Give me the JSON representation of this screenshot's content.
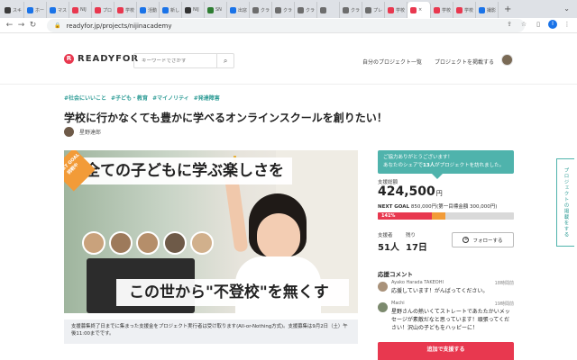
{
  "browser": {
    "tabs": [
      {
        "label": "スキ",
        "color": "#3c3c3c"
      },
      {
        "label": "ホー",
        "color": "#1a73e8"
      },
      {
        "label": "マス",
        "color": "#1a73e8"
      },
      {
        "label": "NIJ",
        "color": "#e8384f"
      },
      {
        "label": "プロ",
        "color": "#e8384f"
      },
      {
        "label": "学校",
        "color": "#e8384f"
      },
      {
        "label": "活動",
        "color": "#1a73e8"
      },
      {
        "label": "新し",
        "color": "#1a73e8"
      },
      {
        "label": "NIJ",
        "color": "#333333"
      },
      {
        "label": "SN",
        "color": "#2e7d32"
      },
      {
        "label": "出窓",
        "color": "#1a73e8"
      },
      {
        "label": "クラ",
        "color": "#6d6d6d"
      },
      {
        "label": "クラ",
        "color": "#6d6d6d"
      },
      {
        "label": "クラ",
        "color": "#6d6d6d"
      },
      {
        "label": "",
        "color": "#6d6d6d"
      },
      {
        "label": "クラ",
        "color": "#6d6d6d"
      },
      {
        "label": "プレ",
        "color": "#6d6d6d"
      },
      {
        "label": "学校",
        "color": "#e8384f"
      },
      {
        "label": "学校",
        "color": "#e8384f"
      },
      {
        "label": "学校",
        "color": "#e8384f"
      },
      {
        "label": "撮影",
        "color": "#1a73e8"
      }
    ],
    "active_tab": "×",
    "new_tab": "+",
    "url": "readyfor.jp/projects/nijinacademy",
    "profile_initial": "I"
  },
  "header": {
    "logo": "READYFOR",
    "search_placeholder": "キーワードでさがす",
    "my_projects": "自分のプロジェクト一覧",
    "post_project": "プロジェクトを掲載する"
  },
  "project": {
    "tags": [
      "#社会にいいこと",
      "#子ども・教育",
      "#マイノリティ",
      "#発達障害"
    ],
    "title": "学校に行かなくても豊かに学べるオンラインスクールを創りたい！",
    "owner": "星野達郎",
    "hero_line1": "全ての子どもに学ぶ楽しさを",
    "hero_line2": "この世から\"不登校\"を無くす",
    "hero_badge": "NEXT GOAL 挑戦中",
    "notice": "支援募集終了日までに集まった支援金をプロジェクト実行者は受け取ります(All-or-Nothing方式)。支援募集は9月2日（土）午後11:00までです。"
  },
  "sidebar": {
    "thanks_line1": "ご協力ありがとうございます！",
    "thanks_line2_pre": "あなたのシェアで",
    "thanks_count": "13人",
    "thanks_line2_post": "がプロジェクトを訪れました。",
    "amount_label": "支援総額",
    "amount": "424,500",
    "amount_unit": "円",
    "next_goal_label": "NEXT GOAL",
    "next_goal": "850,000円(第一目標金額 300,000円)",
    "progress_text": "141%",
    "progress_fraction": 0.5,
    "supporters_label": "支援者",
    "supporters": "51人",
    "remaining_label": "残り",
    "remaining": "17日",
    "follow": "フォローする",
    "comments_head": "応援コメント",
    "comments": [
      {
        "name": "Ayako Harada TAKEOHI",
        "time": "18時間前",
        "text": "応援しています！がんばってください。"
      },
      {
        "name": "Machi",
        "time": "19時間前",
        "text": "星野さんの熱いくてストレートであたたかいメッセージが素敵だなと思っています！頑張ってください！沢山の子どもをハッピーに！"
      }
    ],
    "support_button": "追加で支援する"
  },
  "side_tab": "プロジェクトの掲載をする"
}
